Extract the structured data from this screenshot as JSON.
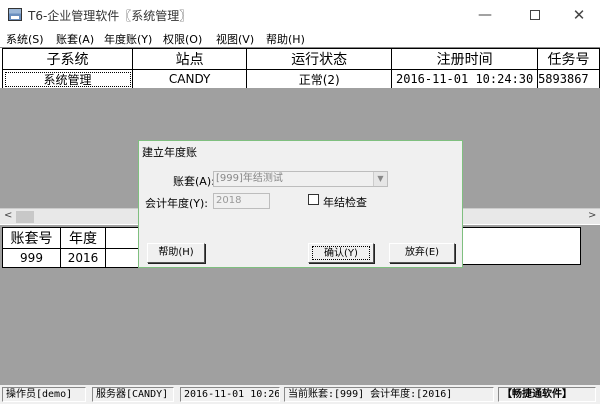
{
  "window": {
    "title": "T6-企业管理软件〖系统管理〗",
    "minimize_icon": "minimize-icon",
    "maximize_icon": "maximize-icon",
    "close_icon": "close-icon"
  },
  "menu": {
    "items": [
      "系统(S)",
      "账套(A)",
      "年度账(Y)",
      "权限(O)",
      "视图(V)",
      "帮助(H)"
    ]
  },
  "top_table": {
    "headers": [
      "子系统",
      "站点",
      "运行状态",
      "注册时间",
      "任务号"
    ],
    "rows": [
      [
        "系统管理",
        "CANDY",
        "正常(2)",
        "2016-11-01 10:24:30",
        "5893867"
      ]
    ]
  },
  "bottom_table": {
    "headers": [
      "账套号",
      "年度"
    ],
    "rows": [
      [
        "999",
        "2016"
      ]
    ]
  },
  "dialog": {
    "title": "建立年度账",
    "account_label": "账套(A):",
    "account_value": "[999]年结测试",
    "year_label": "会计年度(Y):",
    "year_value": "2018",
    "check_label": "年结检查",
    "check_checked": false,
    "help_button": "帮助(H)",
    "ok_button": "确认(Y)",
    "cancel_button": "放弃(E)"
  },
  "status": {
    "operator": "操作员[demo]",
    "server": "服务器[CANDY]",
    "datetime": "2016-11-01 10:26",
    "current": "当前账套:[999] 会计年度:[2016]",
    "brand": "【畅捷通软件】"
  }
}
